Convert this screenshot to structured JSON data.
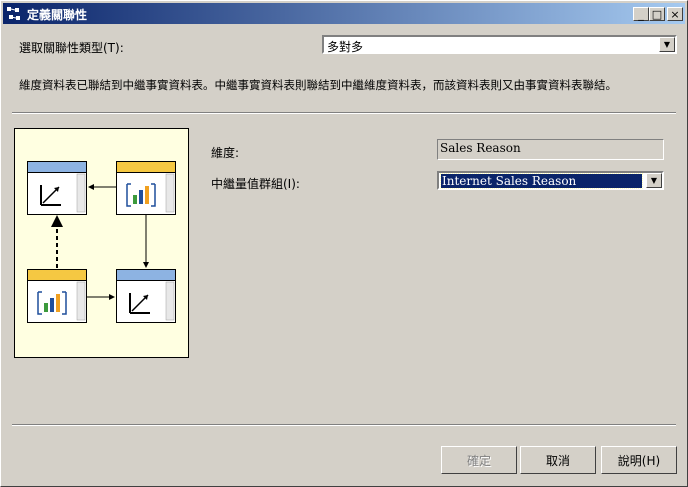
{
  "window": {
    "title": "定義關聯性"
  },
  "title_buttons": {
    "minimize": "_",
    "maximize": "□",
    "close": "×"
  },
  "relation_type": {
    "label": "選取關聯性類型(T):",
    "value": "多對多"
  },
  "description": "維度資料表已聯結到中繼事實資料表。中繼事實資料表則聯結到中繼維度資料表，而該資料表則又由事實資料表聯結。",
  "dimension": {
    "label": "維度:",
    "value": "Sales Reason"
  },
  "intermediate": {
    "label": "中繼量值群組(I):",
    "value": "Internet Sales Reason"
  },
  "buttons": {
    "ok": "確定",
    "cancel": "取消",
    "help": "說明(H)"
  },
  "colors": {
    "dimension_header": "#8db3e2",
    "fact_header": "#f5c842",
    "diagram_bg": "#ffffe1"
  }
}
